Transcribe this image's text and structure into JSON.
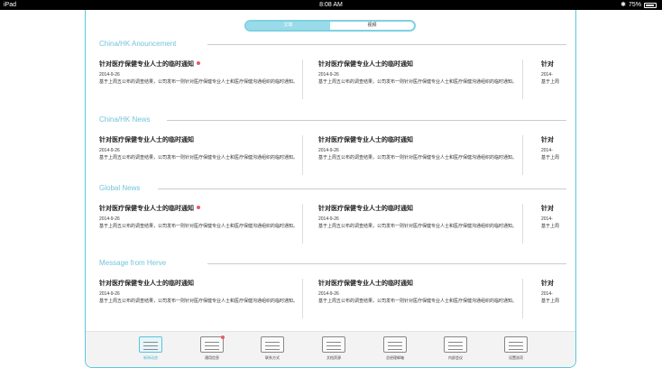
{
  "status": {
    "device": "iPad",
    "time": "8:08 AM",
    "battery": "75%"
  },
  "segment": {
    "options": [
      "文章",
      "视频"
    ],
    "selected": 0
  },
  "sections": [
    {
      "title": "China/HK Anouncement",
      "items": [
        {
          "title": "针对医疗保健专业人士的临时通知",
          "date": "2014-9-26",
          "excerpt": "基于上周五公布的调查结果，公司发布一则针对医疗保健专业人士和医疗保健沟通组织的临时通知。",
          "new": true
        },
        {
          "title": "针对医疗保健专业人士的临时通知",
          "date": "2014-9-26",
          "excerpt": "基于上周五公布的调查结果，公司发布一则针对医疗保健专业人士和医疗保健沟通组织的临时通知。",
          "new": false
        },
        {
          "title": "针对",
          "date": "2014-",
          "excerpt": "基于上周",
          "new": false
        }
      ]
    },
    {
      "title": "China/HK News",
      "items": [
        {
          "title": "针对医疗保健专业人士的临时通知",
          "date": "2014-9-26",
          "excerpt": "基于上周五公布的调查结果，公司发布一则针对医疗保健专业人士和医疗保健沟通组织的临时通知。",
          "new": false
        },
        {
          "title": "针对医疗保健专业人士的临时通知",
          "date": "2014-9-26",
          "excerpt": "基于上周五公布的调查结果，公司发布一则针对医疗保健专业人士和医疗保健沟通组织的临时通知。",
          "new": false
        },
        {
          "title": "针对",
          "date": "2014-",
          "excerpt": "基于上周",
          "new": false
        }
      ]
    },
    {
      "title": "Global News",
      "items": [
        {
          "title": "针对医疗保健专业人士的临时通知",
          "date": "2014-9-26",
          "excerpt": "基于上周五公布的调查结果，公司发布一则针对医疗保健专业人士和医疗保健沟通组织的临时通知。",
          "new": true
        },
        {
          "title": "针对医疗保健专业人士的临时通知",
          "date": "2014-9-26",
          "excerpt": "基于上周五公布的调查结果，公司发布一则针对医疗保健专业人士和医疗保健沟通组织的临时通知。",
          "new": false
        },
        {
          "title": "针对",
          "date": "2014-",
          "excerpt": "基于上周",
          "new": false
        }
      ]
    },
    {
      "title": "Message from Herve",
      "items": [
        {
          "title": "针对医疗保健专业人士的临时通知",
          "date": "2014-9-26",
          "excerpt": "基于上周五公布的调查结果，公司发布一则针对医疗保健专业人士和医疗保健沟通组织的临时通知。",
          "new": false
        },
        {
          "title": "针对医疗保健专业人士的临时通知",
          "date": "2014-9-26",
          "excerpt": "基于上周五公布的调查结果，公司发布一则针对医疗保健专业人士和医疗保健沟通组织的临时通知。",
          "new": false
        },
        {
          "title": "针对",
          "date": "2014-",
          "excerpt": "基于上周",
          "new": false
        }
      ]
    }
  ],
  "tabs": [
    {
      "label": "新闻动态",
      "icon": "news-icon",
      "active": true
    },
    {
      "label": "通用信息",
      "icon": "chat-icon",
      "active": false,
      "badge": true
    },
    {
      "label": "联系方式",
      "icon": "contact-card-icon",
      "active": false
    },
    {
      "label": "文档资源",
      "icon": "book-icon",
      "active": false
    },
    {
      "label": "总经理邮箱",
      "icon": "mail-icon",
      "active": false
    },
    {
      "label": "内部会议",
      "icon": "group-icon",
      "active": false
    },
    {
      "label": "设置选项",
      "icon": "gear-icon",
      "active": false
    }
  ],
  "colors": {
    "accent": "#5cc6dd",
    "badge": "#e8586a"
  }
}
